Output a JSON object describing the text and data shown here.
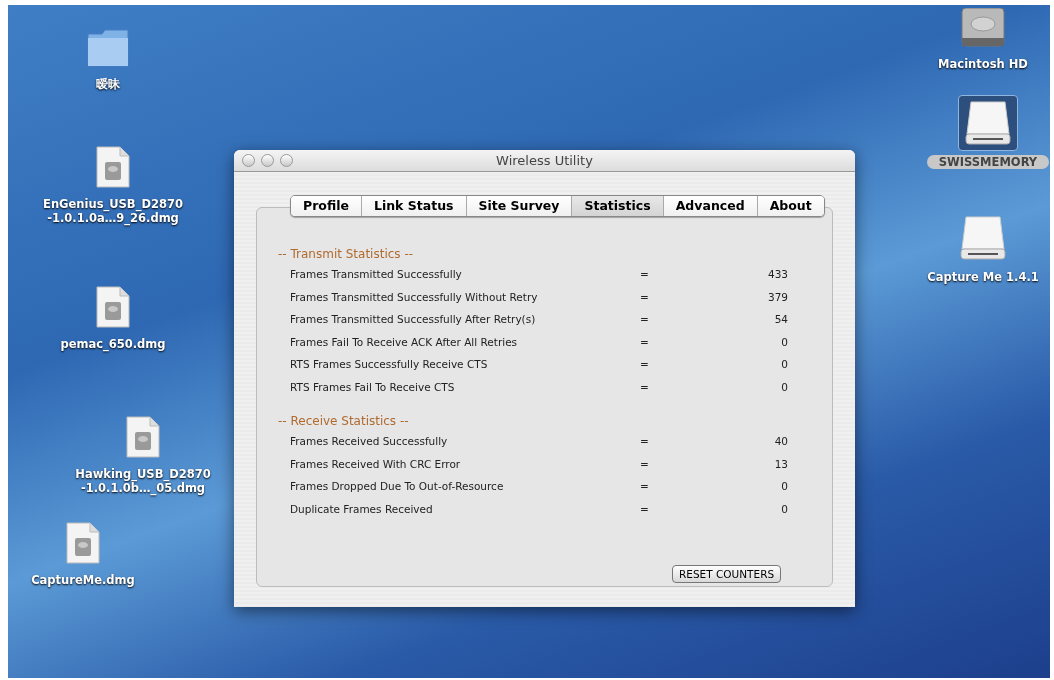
{
  "desktop_icons": [
    {
      "kind": "folder",
      "label": "暧昧",
      "selected": false
    },
    {
      "kind": "disk-image",
      "label": "EnGenius_USB_D2870\n-1.0.1.0a…9_26.dmg",
      "selected": false
    },
    {
      "kind": "disk-image",
      "label": "pemac_650.dmg",
      "selected": false
    },
    {
      "kind": "disk-image",
      "label": "Hawking_USB_D2870\n-1.0.1.0b…_05.dmg",
      "selected": false
    },
    {
      "kind": "disk-image",
      "label": "CaptureMe.dmg",
      "selected": false
    },
    {
      "kind": "hard-disk",
      "label": "Macintosh HD",
      "selected": false
    },
    {
      "kind": "drive",
      "label": "SWISSMEMORY",
      "selected": true
    },
    {
      "kind": "drive",
      "label": "Capture Me 1.4.1",
      "selected": false
    }
  ],
  "window": {
    "title": "Wireless Utility",
    "tabs": [
      {
        "label": "Profile",
        "selected": false
      },
      {
        "label": "Link Status",
        "selected": false
      },
      {
        "label": "Site Survey",
        "selected": false
      },
      {
        "label": "Statistics",
        "selected": true
      },
      {
        "label": "Advanced",
        "selected": false
      },
      {
        "label": "About",
        "selected": false
      }
    ],
    "sections": [
      {
        "title": "-- Transmit Statistics --",
        "rows": [
          {
            "label": "Frames Transmitted Successfully",
            "sign": "=",
            "value": "433"
          },
          {
            "label": "Frames Transmitted Successfully Without Retry",
            "sign": "=",
            "value": "379"
          },
          {
            "label": "Frames Transmitted Successfully After Retry(s)",
            "sign": "=",
            "value": "54"
          },
          {
            "label": "Frames Fail To Receive ACK After All Retries",
            "sign": "=",
            "value": "0"
          },
          {
            "label": "RTS Frames Successfully Receive CTS",
            "sign": "=",
            "value": "0"
          },
          {
            "label": "RTS Frames Fail To Receive CTS",
            "sign": "=",
            "value": "0"
          }
        ]
      },
      {
        "title": "-- Receive Statistics --",
        "rows": [
          {
            "label": "Frames Received Successfully",
            "sign": "=",
            "value": "40"
          },
          {
            "label": "Frames Received With CRC Error",
            "sign": "=",
            "value": "13"
          },
          {
            "label": "Frames Dropped Due To Out-of-Resource",
            "sign": "=",
            "value": "0"
          },
          {
            "label": "Duplicate Frames Received",
            "sign": "=",
            "value": "0"
          }
        ]
      }
    ],
    "reset_button": "RESET COUNTERS"
  }
}
